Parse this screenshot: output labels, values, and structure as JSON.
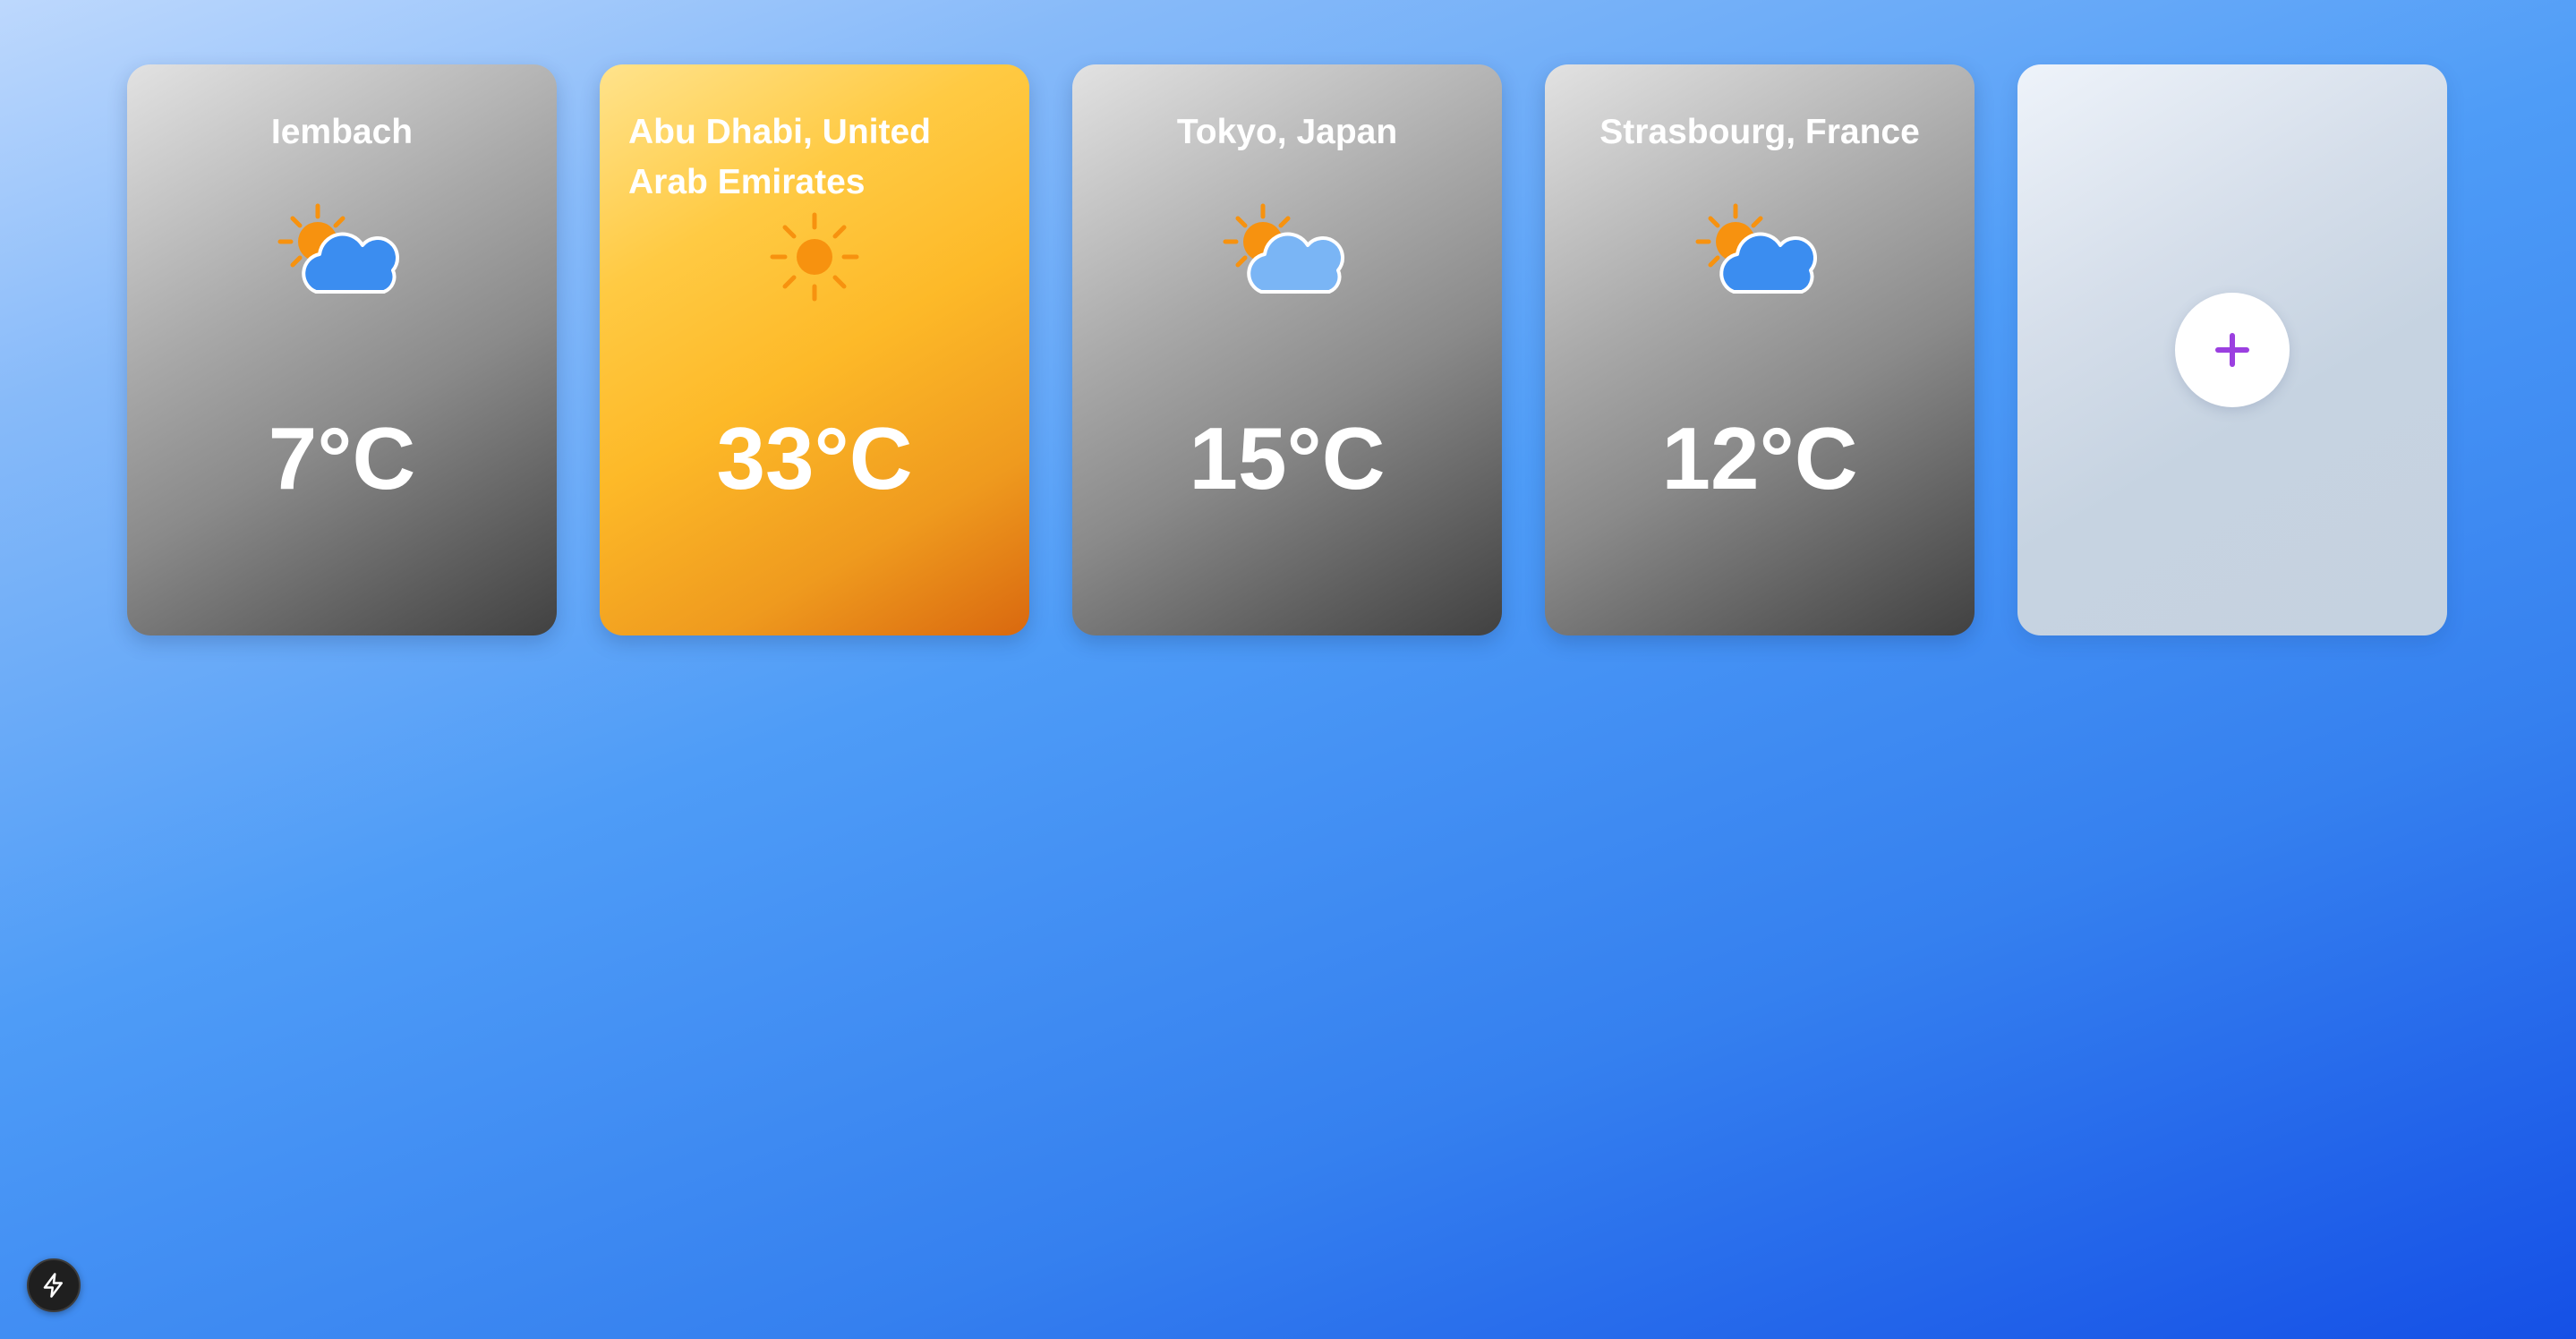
{
  "cards": [
    {
      "city": "Iembach",
      "condition": "partly-cloudy",
      "temperature": "7°C",
      "theme": "gray"
    },
    {
      "city": "Abu Dhabi, United Arab Emirates",
      "condition": "sunny",
      "temperature": "33°C",
      "theme": "orange"
    },
    {
      "city": "Tokyo, Japan",
      "condition": "partly-cloudy",
      "temperature": "15°C",
      "theme": "gray"
    },
    {
      "city": "Strasbourg, France",
      "condition": "partly-cloudy",
      "temperature": "12°C",
      "theme": "gray"
    }
  ],
  "add_card": {
    "icon": "plus-icon",
    "accent": "#9b3fe0"
  },
  "fab": {
    "icon": "lightning-icon"
  },
  "colors": {
    "sun": "#f7920f",
    "cloud_dark": "#3b8df0",
    "cloud_light": "#7ab5f5",
    "background_top": "#bdd8fd",
    "background_bottom": "#1550e6"
  }
}
